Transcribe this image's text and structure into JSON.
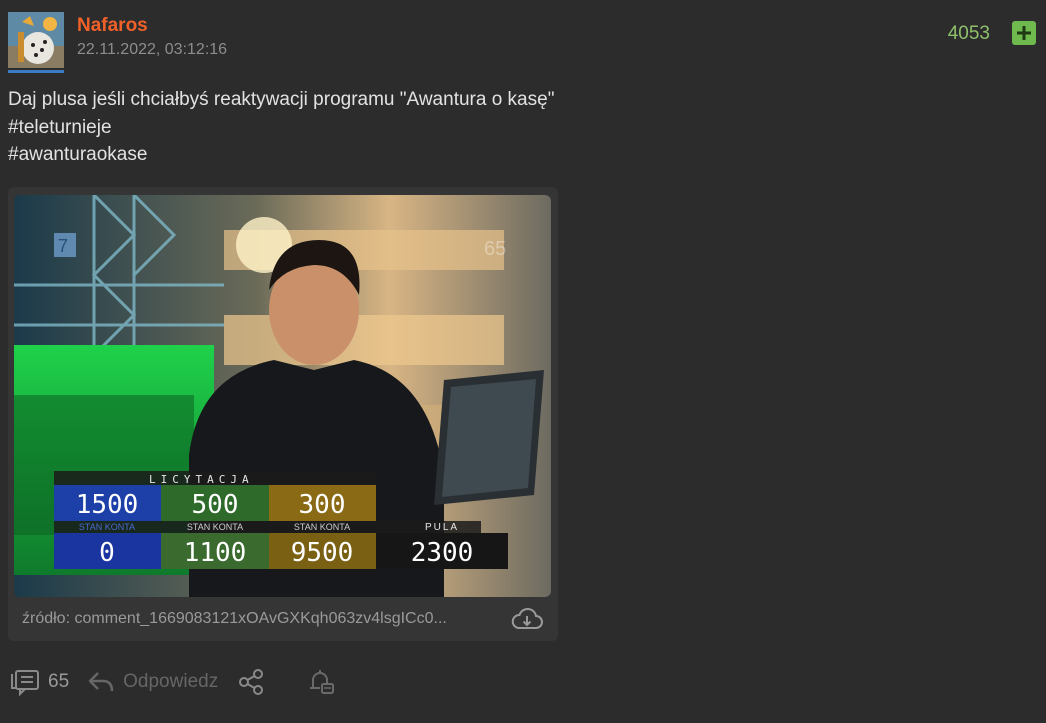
{
  "post": {
    "author": "Nafaros",
    "date": "22.11.2022, 03:12:16",
    "votes": "4053",
    "lines": [
      "Daj plusa jeśli chciałbyś reaktywacji programu \"Awantura o kasę\"",
      "#teleturnieje",
      "#awanturaokase"
    ]
  },
  "media": {
    "source": "źródło: comment_1669083121xOAvGXKqh063zv4lsgICc0...",
    "scoreboard": {
      "title": "LICYTACJA",
      "bids": [
        "1500",
        "500",
        "300"
      ],
      "account_label": "STAN KONTA",
      "accounts": [
        "0",
        "1100",
        "9500"
      ],
      "pool_label": "PULA",
      "pool": "2300",
      "channel": "7",
      "watermark": "65"
    }
  },
  "actions": {
    "comments_count": "65",
    "reply_label": "Odpowiedz"
  },
  "icons": {
    "plus": "plus-icon",
    "download": "download-cloud-icon",
    "comments": "comments-icon",
    "reply": "reply-icon",
    "share": "share-icon",
    "notify": "bell-icon"
  },
  "colors": {
    "author": "#f0612a",
    "votes": "#8ec06b",
    "plus_button": "#6fb94f",
    "background": "#2c2c2d"
  }
}
